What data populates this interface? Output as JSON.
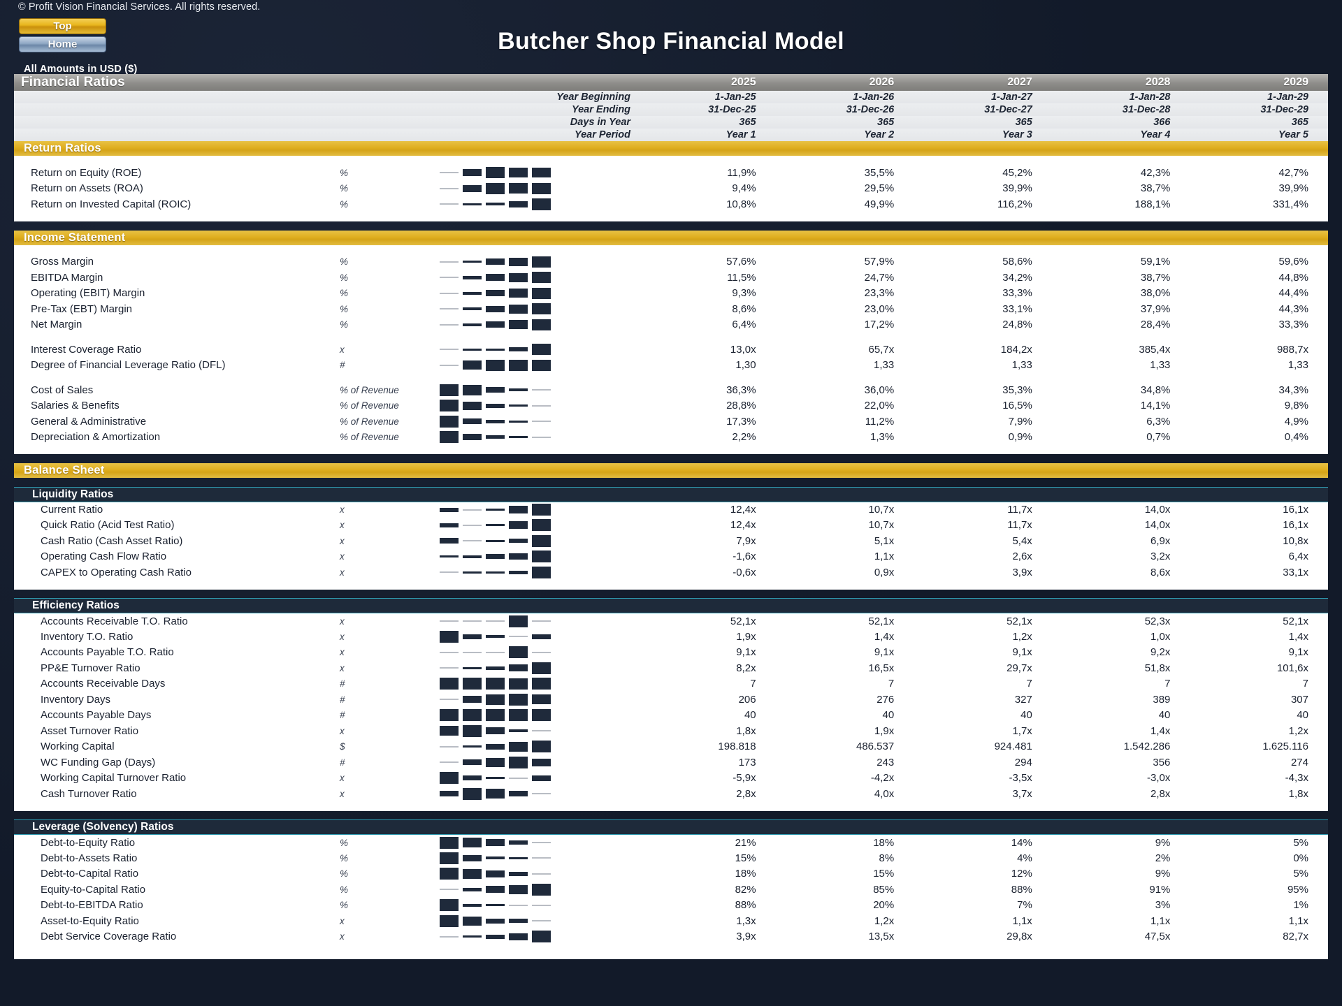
{
  "meta": {
    "copyright": "© Profit Vision Financial Services. All rights reserved.",
    "title": "Butcher Shop Financial Model",
    "amounts_note": "All Amounts in  USD ($)",
    "accent_gold": "#dfae1f",
    "accent_teal": "#1c8296",
    "accent_dark": "#1e2a3a"
  },
  "nav": {
    "top_label": "Top",
    "home_label": "Home"
  },
  "sheet": {
    "section_title": "Financial Ratios",
    "years": [
      "2025",
      "2026",
      "2027",
      "2028",
      "2029"
    ],
    "header_rows": [
      {
        "label": "Year Beginning",
        "values": [
          "1-Jan-25",
          "1-Jan-26",
          "1-Jan-27",
          "1-Jan-28",
          "1-Jan-29"
        ]
      },
      {
        "label": "Year Ending",
        "values": [
          "31-Dec-25",
          "31-Dec-26",
          "31-Dec-27",
          "31-Dec-28",
          "31-Dec-29"
        ]
      },
      {
        "label": "Days in Year",
        "values": [
          "365",
          "365",
          "365",
          "366",
          "365"
        ]
      },
      {
        "label": "Year Period",
        "values": [
          "Year 1",
          "Year 2",
          "Year 3",
          "Year 4",
          "Year 5"
        ]
      }
    ]
  },
  "chart_data": {
    "type": "table",
    "title": "Financial Ratios",
    "categories": [
      "2025",
      "2026",
      "2027",
      "2028",
      "2029"
    ],
    "xlabel": "Year",
    "ylabel": "",
    "sections": [
      {
        "title": "Return Ratios",
        "style": "gold",
        "rows": [
          {
            "label": "Return on Equity (ROE)",
            "unit": "%",
            "spark": [
              0.05,
              0.55,
              0.85,
              0.72,
              0.74
            ],
            "values": [
              "11,9%",
              "35,5%",
              "45,2%",
              "42,3%",
              "42,7%"
            ]
          },
          {
            "label": "Return on Assets (ROA)",
            "unit": "%",
            "spark": [
              0.05,
              0.55,
              0.85,
              0.8,
              0.84
            ],
            "values": [
              "9,4%",
              "29,5%",
              "39,9%",
              "38,7%",
              "39,9%"
            ]
          },
          {
            "label": "Return on Invested Capital (ROIC)",
            "unit": "%",
            "spark": [
              0.04,
              0.12,
              0.22,
              0.45,
              0.9
            ],
            "values": [
              "10,8%",
              "49,9%",
              "116,2%",
              "188,1%",
              "331,4%"
            ]
          }
        ]
      },
      {
        "title": "Income Statement",
        "style": "gold",
        "rows": [
          {
            "label": "Gross Margin",
            "unit": "%",
            "spark": [
              0.05,
              0.18,
              0.45,
              0.65,
              0.85
            ],
            "values": [
              "57,6%",
              "57,9%",
              "58,6%",
              "59,1%",
              "59,6%"
            ]
          },
          {
            "label": "EBITDA Margin",
            "unit": "%",
            "spark": [
              0.05,
              0.25,
              0.5,
              0.68,
              0.85
            ],
            "values": [
              "11,5%",
              "24,7%",
              "34,2%",
              "38,7%",
              "44,8%"
            ]
          },
          {
            "label": "Operating (EBIT) Margin",
            "unit": "%",
            "spark": [
              0.05,
              0.22,
              0.48,
              0.66,
              0.85
            ],
            "values": [
              "9,3%",
              "23,3%",
              "33,3%",
              "38,0%",
              "44,4%"
            ]
          },
          {
            "label": "Pre-Tax (EBT) Margin",
            "unit": "%",
            "spark": [
              0.05,
              0.22,
              0.48,
              0.66,
              0.85
            ],
            "values": [
              "8,6%",
              "23,0%",
              "33,1%",
              "37,9%",
              "44,3%"
            ]
          },
          {
            "label": "Net Margin",
            "unit": "%",
            "spark": [
              0.05,
              0.22,
              0.48,
              0.66,
              0.85
            ],
            "values": [
              "6,4%",
              "17,2%",
              "24,8%",
              "28,4%",
              "33,3%"
            ]
          },
          {
            "type": "spacer"
          },
          {
            "label": "Interest Coverage Ratio",
            "unit": "x",
            "spark": [
              0.04,
              0.08,
              0.16,
              0.3,
              0.85
            ],
            "values": [
              "13,0x",
              "65,7x",
              "184,2x",
              "385,4x",
              "988,7x"
            ]
          },
          {
            "label": "Degree of Financial Leverage Ratio (DFL)",
            "unit": "#",
            "spark": [
              0.05,
              0.7,
              0.85,
              0.85,
              0.85
            ],
            "values": [
              "1,30",
              "1,33",
              "1,33",
              "1,33",
              "1,33"
            ]
          },
          {
            "type": "spacer"
          },
          {
            "label": "Cost of Sales",
            "unit": "% of Revenue",
            "spark": [
              0.88,
              0.8,
              0.4,
              0.22,
              0.05
            ],
            "values": [
              "36,3%",
              "36,0%",
              "35,3%",
              "34,8%",
              "34,3%"
            ]
          },
          {
            "label": "Salaries & Benefits",
            "unit": "% of Revenue",
            "spark": [
              0.88,
              0.62,
              0.32,
              0.18,
              0.05
            ],
            "values": [
              "28,8%",
              "22,0%",
              "16,5%",
              "14,1%",
              "9,8%"
            ]
          },
          {
            "label": "General & Administrative",
            "unit": "% of Revenue",
            "spark": [
              0.88,
              0.44,
              0.24,
              0.14,
              0.05
            ],
            "values": [
              "17,3%",
              "11,2%",
              "7,9%",
              "6,3%",
              "4,9%"
            ]
          },
          {
            "label": "Depreciation & Amortization",
            "unit": "% of Revenue",
            "spark": [
              0.88,
              0.45,
              0.24,
              0.14,
              0.05
            ],
            "values": [
              "2,2%",
              "1,3%",
              "0,9%",
              "0,7%",
              "0,4%"
            ]
          }
        ]
      },
      {
        "title": "Balance Sheet",
        "style": "gold",
        "rows": []
      },
      {
        "title": "Liquidity Ratios",
        "style": "dark",
        "indent": true,
        "rows": [
          {
            "label": "Current Ratio",
            "unit": "x",
            "spark": [
              0.32,
              0.05,
              0.18,
              0.6,
              0.9
            ],
            "values": [
              "12,4x",
              "10,7x",
              "11,7x",
              "14,0x",
              "16,1x"
            ]
          },
          {
            "label": "Quick Ratio (Acid Test Ratio)",
            "unit": "x",
            "spark": [
              0.32,
              0.05,
              0.18,
              0.6,
              0.9
            ],
            "values": [
              "12,4x",
              "10,7x",
              "11,7x",
              "14,0x",
              "16,1x"
            ]
          },
          {
            "label": "Cash Ratio (Cash Asset Ratio)",
            "unit": "x",
            "spark": [
              0.42,
              0.05,
              0.12,
              0.32,
              0.9
            ],
            "values": [
              "7,9x",
              "5,1x",
              "5,4x",
              "6,9x",
              "10,8x"
            ]
          },
          {
            "label": "Operating Cash Flow Ratio",
            "unit": "x",
            "spark": [
              0.08,
              0.22,
              0.38,
              0.46,
              0.9
            ],
            "values": [
              "-1,6x",
              "1,1x",
              "2,6x",
              "3,2x",
              "6,4x"
            ]
          },
          {
            "label": "CAPEX to Operating Cash Ratio",
            "unit": "x",
            "spark": [
              0.04,
              0.08,
              0.14,
              0.26,
              0.9
            ],
            "values": [
              "-0,6x",
              "0,9x",
              "3,9x",
              "8,6x",
              "33,1x"
            ]
          }
        ]
      },
      {
        "title": "Efficiency Ratios",
        "style": "dark",
        "indent": true,
        "rows": [
          {
            "label": "Accounts Receivable T.O. Ratio",
            "unit": "x",
            "spark": [
              0.04,
              0.04,
              0.04,
              0.9,
              0.04
            ],
            "values": [
              "52,1x",
              "52,1x",
              "52,1x",
              "52,3x",
              "52,1x"
            ]
          },
          {
            "label": "Inventory T.O. Ratio",
            "unit": "x",
            "spark": [
              0.9,
              0.38,
              0.2,
              0.04,
              0.38
            ],
            "values": [
              "1,9x",
              "1,4x",
              "1,2x",
              "1,0x",
              "1,4x"
            ]
          },
          {
            "label": "Accounts Payable T.O. Ratio",
            "unit": "x",
            "spark": [
              0.04,
              0.04,
              0.04,
              0.9,
              0.04
            ],
            "values": [
              "9,1x",
              "9,1x",
              "9,1x",
              "9,2x",
              "9,1x"
            ]
          },
          {
            "label": "PP&E Turnover Ratio",
            "unit": "x",
            "spark": [
              0.05,
              0.12,
              0.26,
              0.5,
              0.9
            ],
            "values": [
              "8,2x",
              "16,5x",
              "29,7x",
              "51,8x",
              "101,6x"
            ]
          },
          {
            "label": "Accounts Receivable Days",
            "unit": "#",
            "spark": [
              0.9,
              0.88,
              0.88,
              0.86,
              0.88
            ],
            "values": [
              "7",
              "7",
              "7",
              "7",
              "7"
            ]
          },
          {
            "label": "Inventory Days",
            "unit": "#",
            "spark": [
              0.05,
              0.5,
              0.78,
              0.9,
              0.74
            ],
            "values": [
              "206",
              "276",
              "327",
              "389",
              "307"
            ]
          },
          {
            "label": "Accounts Payable Days",
            "unit": "#",
            "spark": [
              0.9,
              0.88,
              0.88,
              0.88,
              0.88
            ],
            "values": [
              "40",
              "40",
              "40",
              "40",
              "40"
            ]
          },
          {
            "label": "Asset Turnover Ratio",
            "unit": "x",
            "spark": [
              0.72,
              0.9,
              0.55,
              0.2,
              0.05
            ],
            "values": [
              "1,8x",
              "1,9x",
              "1,7x",
              "1,4x",
              "1,2x"
            ]
          },
          {
            "label": "Working Capital",
            "unit": "$",
            "spark": [
              0.04,
              0.18,
              0.4,
              0.72,
              0.9
            ],
            "values": [
              "198.818",
              "486.537",
              "924.481",
              "1.542.286",
              "1.625.116"
            ]
          },
          {
            "label": "WC Funding Gap (Days)",
            "unit": "#",
            "spark": [
              0.05,
              0.42,
              0.7,
              0.9,
              0.6
            ],
            "values": [
              "173",
              "243",
              "294",
              "356",
              "274"
            ]
          },
          {
            "label": "Working Capital Turnover Ratio",
            "unit": "x",
            "spark": [
              0.9,
              0.38,
              0.18,
              0.05,
              0.4
            ],
            "values": [
              "-5,9x",
              "-4,2x",
              "-3,5x",
              "-3,0x",
              "-4,3x"
            ]
          },
          {
            "label": "Cash Turnover Ratio",
            "unit": "x",
            "spark": [
              0.42,
              0.9,
              0.72,
              0.42,
              0.05
            ],
            "values": [
              "2,8x",
              "4,0x",
              "3,7x",
              "2,8x",
              "1,8x"
            ]
          }
        ]
      },
      {
        "title": "Leverage (Solvency) Ratios",
        "style": "dark",
        "indent": true,
        "rows": [
          {
            "label": "Debt-to-Equity Ratio",
            "unit": "%",
            "spark": [
              0.9,
              0.74,
              0.55,
              0.3,
              0.05
            ],
            "values": [
              "21%",
              "18%",
              "14%",
              "9%",
              "5%"
            ]
          },
          {
            "label": "Debt-to-Assets Ratio",
            "unit": "%",
            "spark": [
              0.9,
              0.46,
              0.22,
              0.1,
              0.04
            ],
            "values": [
              "15%",
              "8%",
              "4%",
              "2%",
              "0%"
            ]
          },
          {
            "label": "Debt-to-Capital Ratio",
            "unit": "%",
            "spark": [
              0.9,
              0.74,
              0.55,
              0.34,
              0.05
            ],
            "values": [
              "18%",
              "15%",
              "12%",
              "9%",
              "5%"
            ]
          },
          {
            "label": "Equity-to-Capital Ratio",
            "unit": "%",
            "spark": [
              0.05,
              0.28,
              0.5,
              0.7,
              0.9
            ],
            "values": [
              "82%",
              "85%",
              "88%",
              "91%",
              "95%"
            ]
          },
          {
            "label": "Debt-to-EBITDA Ratio",
            "unit": "%",
            "spark": [
              0.9,
              0.22,
              0.1,
              0.06,
              0.04
            ],
            "values": [
              "88%",
              "20%",
              "7%",
              "3%",
              "1%"
            ]
          },
          {
            "label": "Asset-to-Equity Ratio",
            "unit": "x",
            "spark": [
              0.9,
              0.66,
              0.38,
              0.3,
              0.05
            ],
            "values": [
              "1,3x",
              "1,2x",
              "1,1x",
              "1,1x",
              "1,1x"
            ]
          },
          {
            "label": "Debt Service Coverage Ratio",
            "unit": "x",
            "spark": [
              0.04,
              0.14,
              0.3,
              0.5,
              0.9
            ],
            "values": [
              "3,9x",
              "13,5x",
              "29,8x",
              "47,5x",
              "82,7x"
            ]
          }
        ]
      }
    ]
  }
}
